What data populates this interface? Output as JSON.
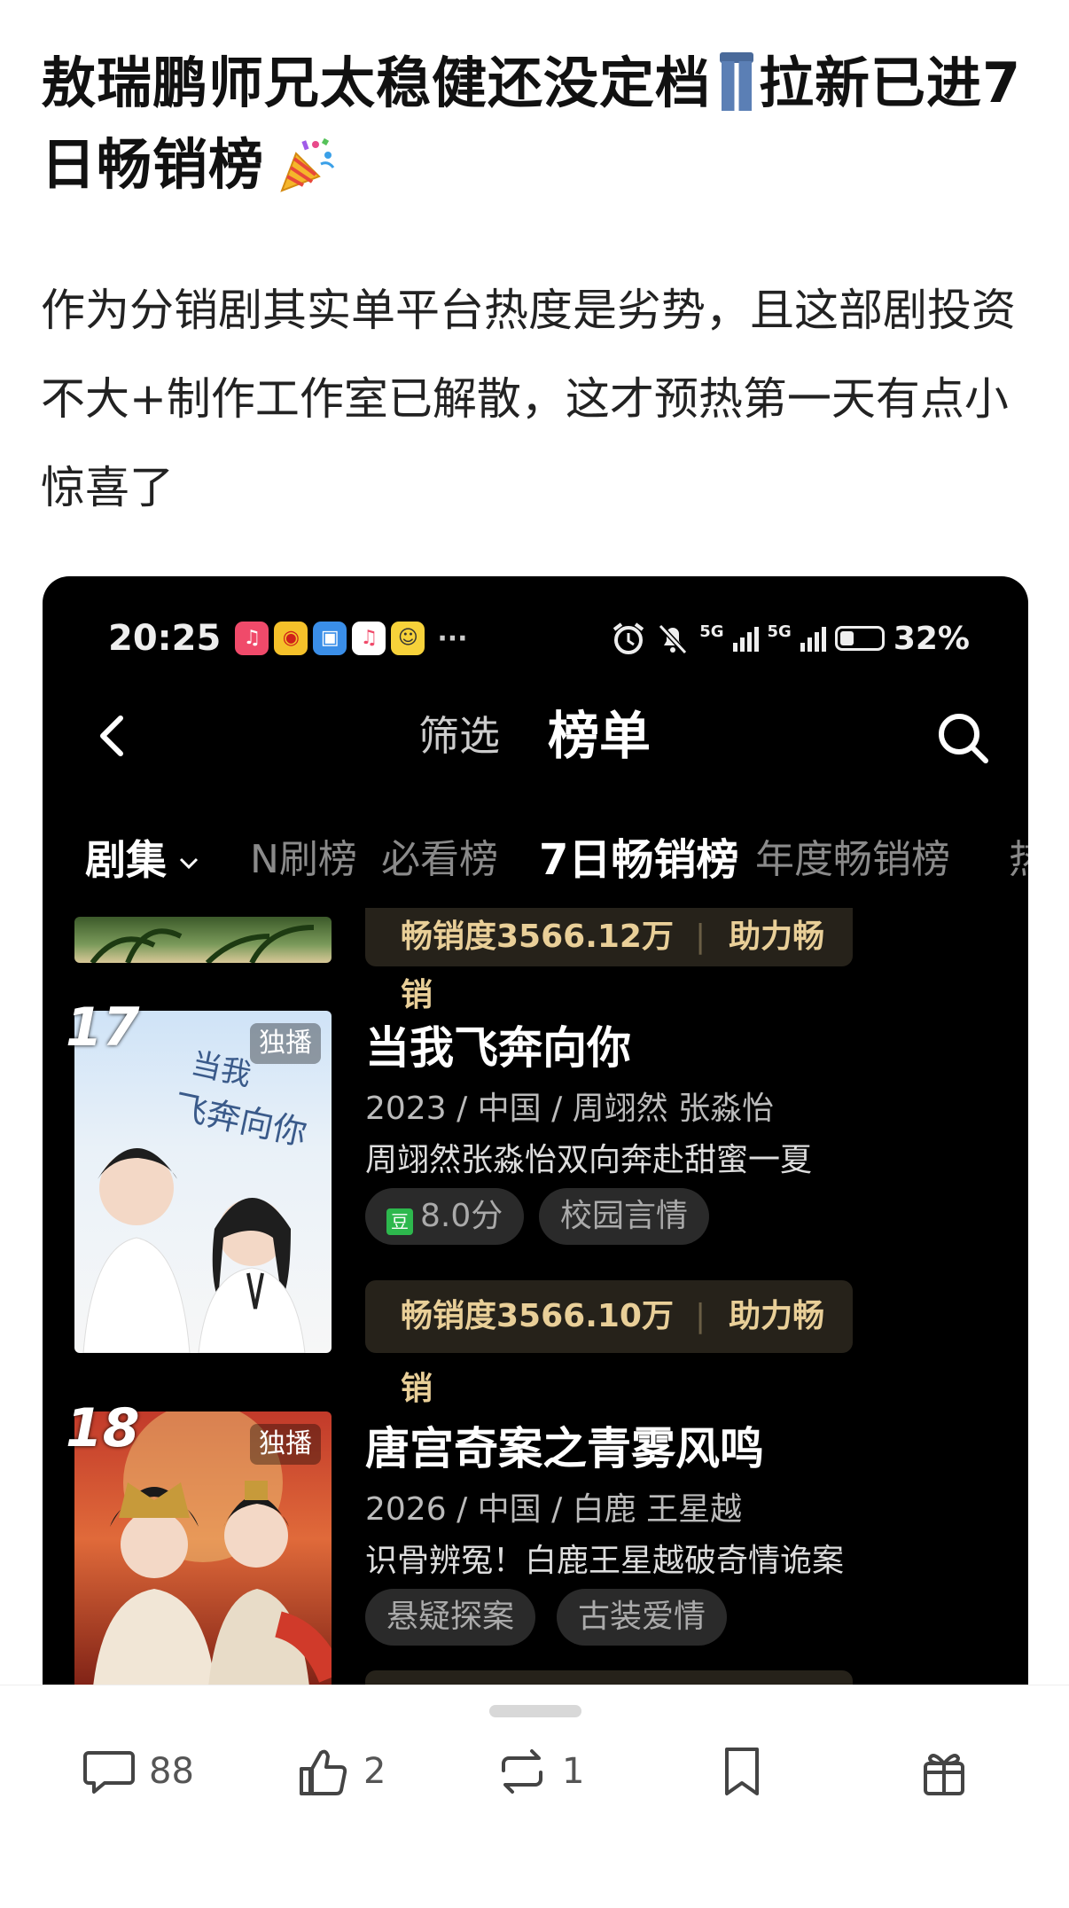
{
  "post": {
    "title": "敖瑞鹏师兄太稳健还没定档",
    "title_2": "拉新已进7日畅销榜",
    "body": "作为分销剧其实单平台热度是劣势，且这部剧投资不大+制作工作室已解散，这才预热第一天有点小惊喜了"
  },
  "screenshot": {
    "status_bar": {
      "time": "20:25",
      "more": "···",
      "net1": "5G",
      "net2": "5G",
      "battery": "32%",
      "app_icons": [
        "music-icon",
        "weibo-icon",
        "app-icon",
        "music-icon",
        "game-icon"
      ]
    },
    "nav": {
      "filter": "筛选",
      "title": "榜单"
    },
    "tabs": [
      {
        "label": "剧集"
      },
      {
        "label": "N刷榜"
      },
      {
        "label": "必看榜"
      },
      {
        "label": "7日畅销榜"
      },
      {
        "label": "年度畅销榜"
      },
      {
        "label": "热"
      }
    ],
    "items": [
      {
        "sales_label": "畅销度3566.12万",
        "boost_label": "助力畅销"
      },
      {
        "rank": "17",
        "badge": "独播",
        "title": "当我飞奔向你",
        "year": "2023",
        "region": "中国",
        "cast": "周翊然 张淼怡",
        "desc": "周翊然张淼怡双向奔赴甜蜜一夏",
        "douban_icon": "豆",
        "score": "8.0分",
        "tag": "校园言情",
        "sales_label": "畅销度3566.10万",
        "boost_label": "助力畅销"
      },
      {
        "rank": "18",
        "badge": "独播",
        "title": "唐宫奇案之青雾风鸣",
        "year": "2026",
        "region": "中国",
        "cast": "白鹿 王星越",
        "desc": "识骨辨冤！白鹿王星越破奇情诡案",
        "tags": [
          "悬疑探案",
          "古装爱情"
        ]
      }
    ]
  },
  "actions": {
    "comments": "88",
    "likes": "2",
    "reposts": "1"
  }
}
